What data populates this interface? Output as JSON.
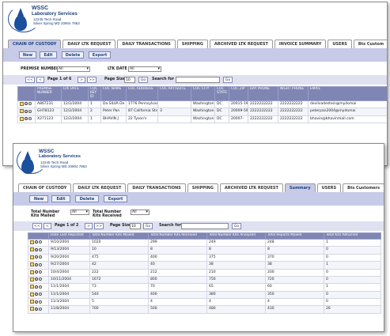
{
  "logo": {
    "org": "WSSC",
    "name": "Laboratory Services",
    "addr1": "12245 Tech Road",
    "addr2": "Silver Spring MD 20904 7863"
  },
  "back": {
    "tabs": [
      "CHAIN OF CUSTODY",
      "DAILY LTK REQUEST",
      "DAILY TRANSACTIONS",
      "SHIPPING",
      "ARCHIVED LTK REQUEST",
      "INVOICE SUMMARY",
      "USERS",
      "Bts Custom"
    ],
    "active_tab": 0,
    "buttons": [
      "New",
      "Edit",
      "Delete",
      "Export"
    ],
    "premise_label": "PREMISE NUMBER",
    "premise_value": "All",
    "ltk_label": "LTK DATE",
    "ltk_value": "All",
    "pager": {
      "first": "<<",
      "prev": "<",
      "page_text": "Page 1 of 6",
      "next": ">",
      "last": ">>",
      "size_label": "Page Size",
      "size_value": "10",
      "go": "Go",
      "search_label": "Search for",
      "search_value": "",
      "search_go": "Go"
    },
    "columns": [
      "",
      "PREMISE NUMBER",
      "LTK DATE",
      "COC KEY ID",
      "COC NAME",
      "COC ADDRESS",
      "COC APT/SUITE",
      "COC CITY",
      "COC STATE",
      "COC ZIP",
      "DAY PHONE",
      "NIGHT PHONE",
      "EMAIL"
    ],
    "rows": [
      [
        "A867231",
        "12/2/2004",
        "1",
        "Da SILVA De STEIN",
        "1776 Pennsylvania Liberty Avenue",
        "",
        "Washington",
        "DC",
        "20015-1945",
        "2222222222",
        "2222222222",
        "devilvadestein@mydomai"
      ],
      [
        "GH78123",
        "12/2/2004",
        "2",
        "Peter Pan",
        "87 California Street",
        "3",
        "Washington",
        "DC",
        "20009-5901",
        "2222222222",
        "2222222222",
        "peterpan2004@mydomai"
      ],
      [
        "X271123",
        "12/2/2004",
        "1",
        "BHAVIN J",
        "22 Tyson's",
        "",
        "Washington",
        "DC",
        "20007-",
        "2222222222",
        "2222222222",
        "bhavin@bhavinmail.com"
      ]
    ]
  },
  "front": {
    "tabs": [
      "CHAIN OF CUSTODY",
      "DAILY LTK REQUEST",
      "DAILY TRANSACTIONS",
      "SHIPPING",
      "ARCHIVED LTK REQUEST",
      "Summary",
      "USERS",
      "Bts Customers"
    ],
    "active_tab": 5,
    "buttons": [
      "New",
      "Edit",
      "Delete",
      "Export"
    ],
    "mailed_label": "Total Number Kits Mailed",
    "mailed_value": "All",
    "received_label": "Total Number Kits Received",
    "received_value": "All",
    "pager": {
      "first": "<<",
      "prev": "<",
      "page_text": "Page 1 of 2",
      "next": ">",
      "last": ">>",
      "size_label": "Page Size",
      "size_value": "10",
      "go": "Go",
      "search_label": "Search for",
      "search_value": "",
      "search_go": "Go"
    },
    "columns": [
      "",
      "Date Last Reported",
      "Total Number Kits Mailed",
      "Total Number Kits Received",
      "Total Number Kits Analyzed",
      "Total Reports Mailed",
      "Total Kits Returned"
    ],
    "rows": [
      [
        "9/10/2004",
        "1020",
        "299",
        "249",
        "248",
        "1"
      ],
      [
        "9/13/2004",
        "10",
        "8",
        "8",
        "8",
        "0"
      ],
      [
        "9/20/2004",
        "475",
        "400",
        "375",
        "370",
        "0"
      ],
      [
        "9/27/2004",
        "42",
        "40",
        "38",
        "38",
        "1"
      ],
      [
        "10/4/2004",
        "222",
        "212",
        "210",
        "200",
        "0"
      ],
      [
        "10/11/2004",
        "1672",
        "800",
        "750",
        "720",
        "0"
      ],
      [
        "11/1/2004",
        "73",
        "70",
        "65",
        "60",
        "1"
      ],
      [
        "11/1/2004",
        "540",
        "400",
        "380",
        "350",
        "0"
      ],
      [
        "11/3/2004",
        "5",
        "4",
        "4",
        "4",
        "0"
      ],
      [
        "11/8/2004",
        "700",
        "500",
        "480",
        "430",
        "26"
      ]
    ]
  }
}
